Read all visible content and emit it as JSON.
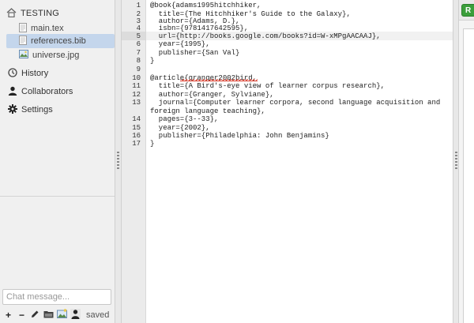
{
  "sidebar": {
    "project_name": "TESTING",
    "files": [
      {
        "name": "main.tex",
        "icon": "document-icon",
        "selected": false
      },
      {
        "name": "references.bib",
        "icon": "document-icon",
        "selected": true
      },
      {
        "name": "universe.jpg",
        "icon": "image-icon",
        "selected": false
      }
    ],
    "nav": [
      {
        "label": "History",
        "icon": "history-icon"
      },
      {
        "label": "Collaborators",
        "icon": "person-icon"
      },
      {
        "label": "Settings",
        "icon": "gear-icon"
      }
    ],
    "chat_placeholder": "Chat message...",
    "toolbar": {
      "add_label": "+",
      "remove_label": "−",
      "status": "saved"
    }
  },
  "editor": {
    "active_line": 5,
    "line_numbers": [
      "1",
      "2",
      "3",
      "4",
      "5",
      "6",
      "7",
      "8",
      "9",
      "10",
      "11",
      "12",
      "13",
      "14",
      "15",
      "16",
      "17"
    ],
    "lines": [
      "@book{adams1995hitchhiker,",
      "  title={The Hitchhiker's Guide to the Galaxy},",
      "  author={Adams, D.},",
      "  isbn={9781417642595},",
      "  url={http://books.google.com/books?id=W-xMPgAACAAJ},",
      "  year={1995},",
      "  publisher={San Val}",
      "}",
      "",
      "@article{granger2002bird,",
      "  title={A Bird's-eye view of learner corpus research},",
      "  author={Granger, Sylviane},",
      "  journal={Computer learner corpora, second language acquisition and",
      "foreign language teaching},",
      "  pages={3--33},",
      "  year={2002},",
      "  publisher={Philadelphia: John Benjamins}",
      "}"
    ]
  },
  "preview": {
    "recompile_label": "R"
  },
  "colors": {
    "selected_file_bg": "#c4d6ec",
    "recompile_green": "#3b9e3b",
    "spellcheck_red": "#d63a2a"
  }
}
